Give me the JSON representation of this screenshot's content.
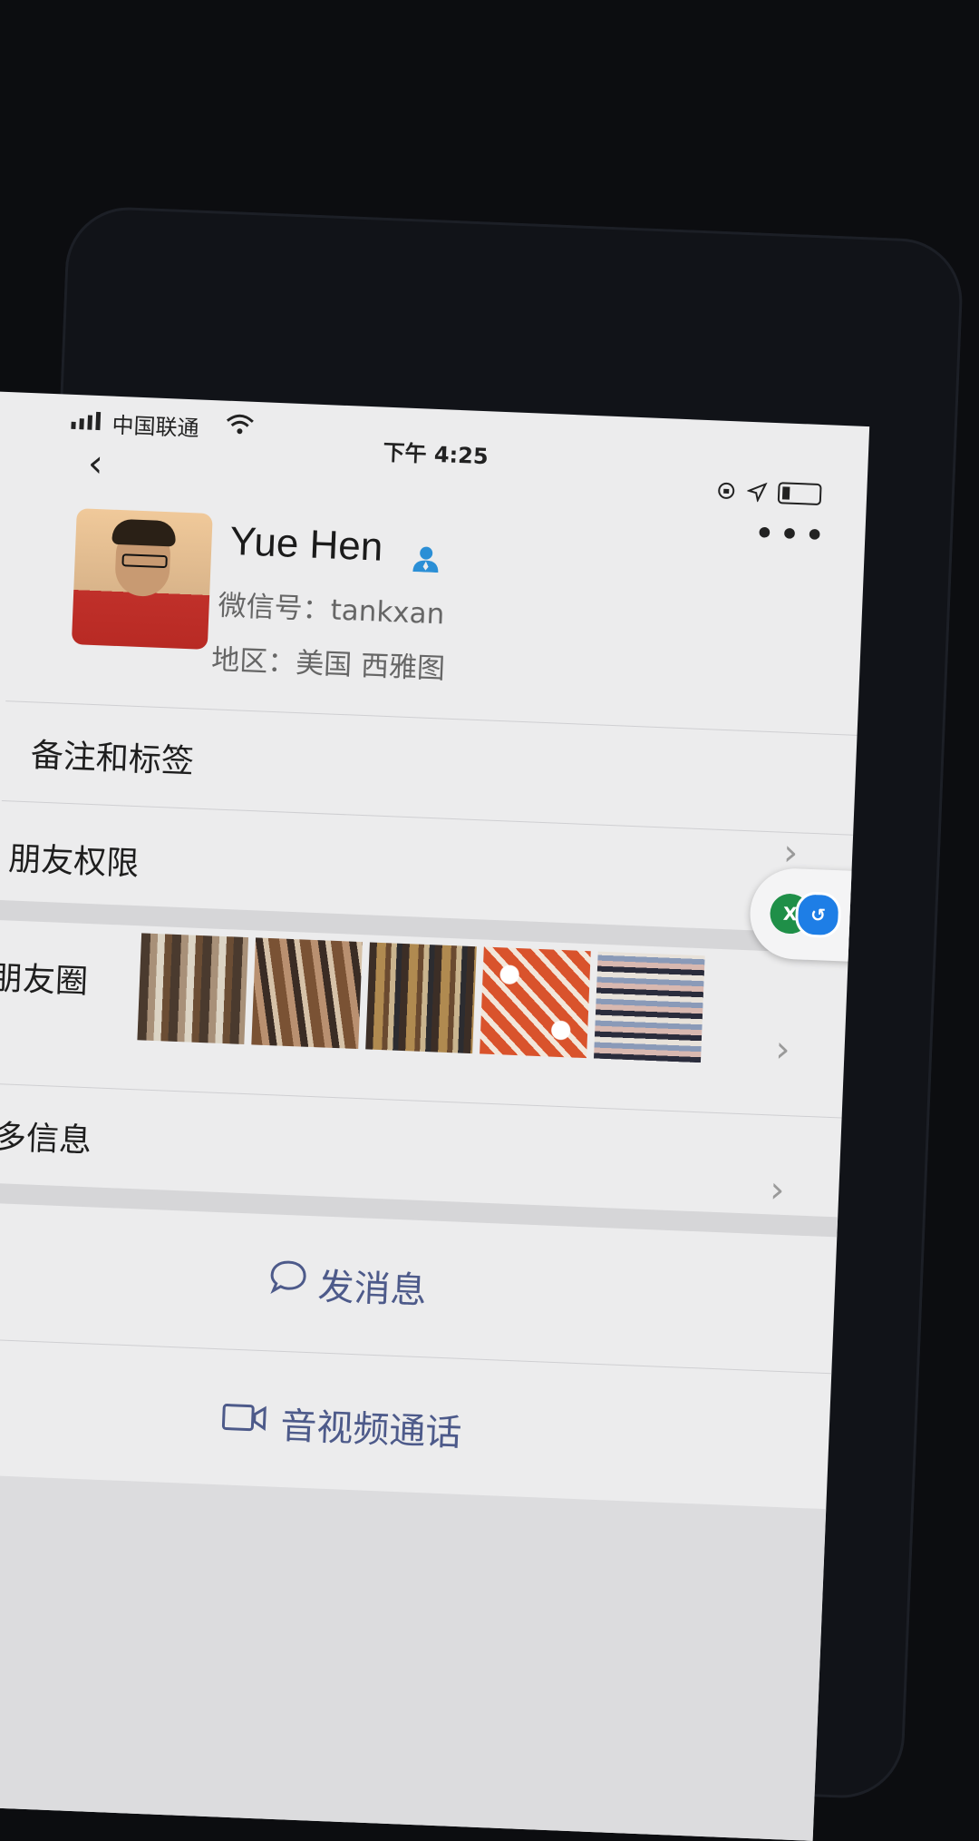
{
  "status_bar": {
    "carrier": "中国联通",
    "time": "下午 4:25",
    "icons": [
      "signal-icon",
      "wifi-icon",
      "orientation-lock-icon",
      "location-icon",
      "battery-icon"
    ]
  },
  "header": {
    "back_icon": "chevron-left-icon",
    "more_icon": "more-icon"
  },
  "profile": {
    "name": "Yue Hen",
    "wechat_id": "微信号：tankxan",
    "region": "地区：美国 西雅图",
    "badge_icon": "contact-person-icon",
    "badge_color": "#2b8fd6"
  },
  "rows": {
    "remarks": "备注和标签",
    "permissions": "朋友权限",
    "moments": "朋友圈",
    "more_info": "更多信息"
  },
  "actions": {
    "message": "发消息",
    "call": "音视频通话",
    "accent_color": "#4d5a8a"
  },
  "floating_ball": {
    "icons": [
      "excel-icon",
      "app-icon"
    ]
  }
}
